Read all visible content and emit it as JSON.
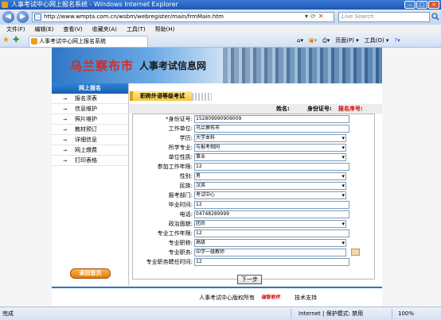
{
  "window": {
    "title": "人事考试中心网上报名系统 - Windows Internet Explorer"
  },
  "address": {
    "url": "http://www.wmpta.com.cn/wsbm/webregister/main/frmMain.htm",
    "search_placeholder": "Live Search"
  },
  "menu": [
    "文件(F)",
    "编辑(E)",
    "查看(V)",
    "收藏夹(A)",
    "工具(T)",
    "帮助(H)"
  ],
  "tab": {
    "label": "人事考试中心网上报名系统"
  },
  "favtools": {
    "page": "页面(P) ▾",
    "tools": "工具(O) ▾"
  },
  "banner": {
    "city": "乌兰察布市",
    "title": "人事考试信息网"
  },
  "sidebar": {
    "header": "网上报名",
    "items": [
      {
        "label": "报名须表"
      },
      {
        "label": "信息维护"
      },
      {
        "label": "照片维护"
      },
      {
        "label": "教材预订"
      },
      {
        "label": "详细信息"
      },
      {
        "label": "网上缴费"
      },
      {
        "label": "打印表格"
      }
    ],
    "back_label": "返回首页"
  },
  "section": {
    "tab_label": "职称外语等级考试"
  },
  "info": {
    "name_label": "姓名:",
    "id_label": "身份证号:",
    "regno_label": "报名序号:"
  },
  "form": {
    "rows": [
      {
        "label": "*身份证号:",
        "value": "152809990909009"
      },
      {
        "label": "工作单位:",
        "value": "乌兰察布市"
      },
      {
        "label": "学历:",
        "value": "大学本科"
      },
      {
        "label": "所学专业:",
        "value": "与报考相同"
      },
      {
        "label": "单位性质:",
        "value": "事业"
      },
      {
        "label": "参加工作年限:",
        "value": "12"
      },
      {
        "label": "性别:",
        "value": "男"
      },
      {
        "label": "民族:",
        "value": "汉族"
      },
      {
        "label": "报考部门:",
        "value": "考试中心"
      },
      {
        "label": "毕业时间:",
        "value": "12"
      },
      {
        "label": "电话:",
        "value": "04748289999"
      },
      {
        "label": "政治面貌:",
        "value": "团员"
      },
      {
        "label": "专业工作年限:",
        "value": "12"
      },
      {
        "label": "专业职称:",
        "value": "高级"
      },
      {
        "label": "专业职务:",
        "value": "中学一级教师"
      },
      {
        "label": "专业职务聘任时间:",
        "value": "12"
      }
    ],
    "next_label": "下一步"
  },
  "footer": {
    "left": "人事考试中心版权所有",
    "logo": "瑞智软件",
    "right": "技术支持"
  },
  "status": {
    "done": "完成",
    "zone": "Internet | 保护模式: 禁用",
    "zoom": "100%"
  },
  "colors": {
    "banner_red": "#d62b1e",
    "sidebar_header": "#1a5fb0",
    "regno_red": "#d00000"
  }
}
